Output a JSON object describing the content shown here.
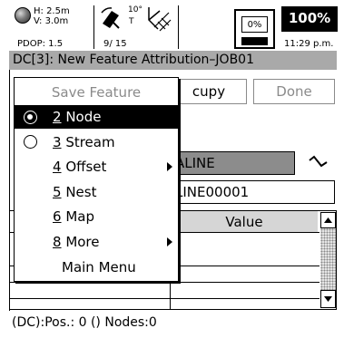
{
  "status": {
    "h_accuracy": "H: 2.5m",
    "v_accuracy": "V: 3.0m",
    "pdop": "PDOP: 1.5",
    "sat_elevation": "10°",
    "sat_mode": "T",
    "sat_counts": "9/ 15",
    "storage_percent": "0%",
    "battery_percent": "100%",
    "clock": "11:29 p.m."
  },
  "title": "DC[3]: New Feature Attribution–JOB01",
  "buttons": {
    "occupy_partial": "cupy",
    "done": "Done"
  },
  "feature": {
    "code_partial": "ALINE",
    "name_partial": "LINE00001"
  },
  "table": {
    "value_header": "Value"
  },
  "menu": {
    "header": "Save Feature",
    "items": [
      {
        "key": "2",
        "rest": " Node",
        "radio": true,
        "checked": true,
        "selected": true,
        "submenu": false
      },
      {
        "key": "3",
        "rest": " Stream",
        "radio": true,
        "checked": false,
        "selected": false,
        "submenu": false
      },
      {
        "key": "4",
        "rest": " Offset",
        "radio": false,
        "checked": false,
        "selected": false,
        "submenu": true
      },
      {
        "key": "5",
        "rest": " Nest",
        "radio": false,
        "checked": false,
        "selected": false,
        "submenu": false
      },
      {
        "key": "6",
        "rest": " Map",
        "radio": false,
        "checked": false,
        "selected": false,
        "submenu": false
      },
      {
        "key": "8",
        "rest": " More",
        "radio": false,
        "checked": false,
        "selected": false,
        "submenu": true
      }
    ],
    "main_menu": "Main Menu"
  },
  "bottom_status": "(DC):Pos.: 0 () Nodes:0"
}
